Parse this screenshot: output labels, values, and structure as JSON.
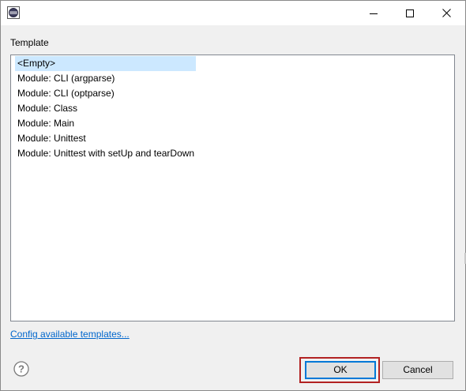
{
  "titlebar": {
    "app_icon": "eclipse-icon",
    "minimize_icon": "minimize-icon",
    "maximize_icon": "maximize-icon",
    "close_icon": "close-icon"
  },
  "template": {
    "label": "Template",
    "items": [
      {
        "label": "<Empty>",
        "selected": true
      },
      {
        "label": "Module: CLI (argparse)",
        "selected": false
      },
      {
        "label": "Module: CLI (optparse)",
        "selected": false
      },
      {
        "label": "Module: Class",
        "selected": false
      },
      {
        "label": "Module: Main",
        "selected": false
      },
      {
        "label": "Module: Unittest",
        "selected": false
      },
      {
        "label": "Module: Unittest with setUp and tearDown",
        "selected": false
      }
    ]
  },
  "config_link": "Config available templates...",
  "footer": {
    "help_icon": "help-icon",
    "ok_label": "OK",
    "cancel_label": "Cancel"
  },
  "colors": {
    "selection": "#cce8ff",
    "link": "#0066cc",
    "default_button_border": "#0078d7",
    "highlight": "#b22222"
  }
}
